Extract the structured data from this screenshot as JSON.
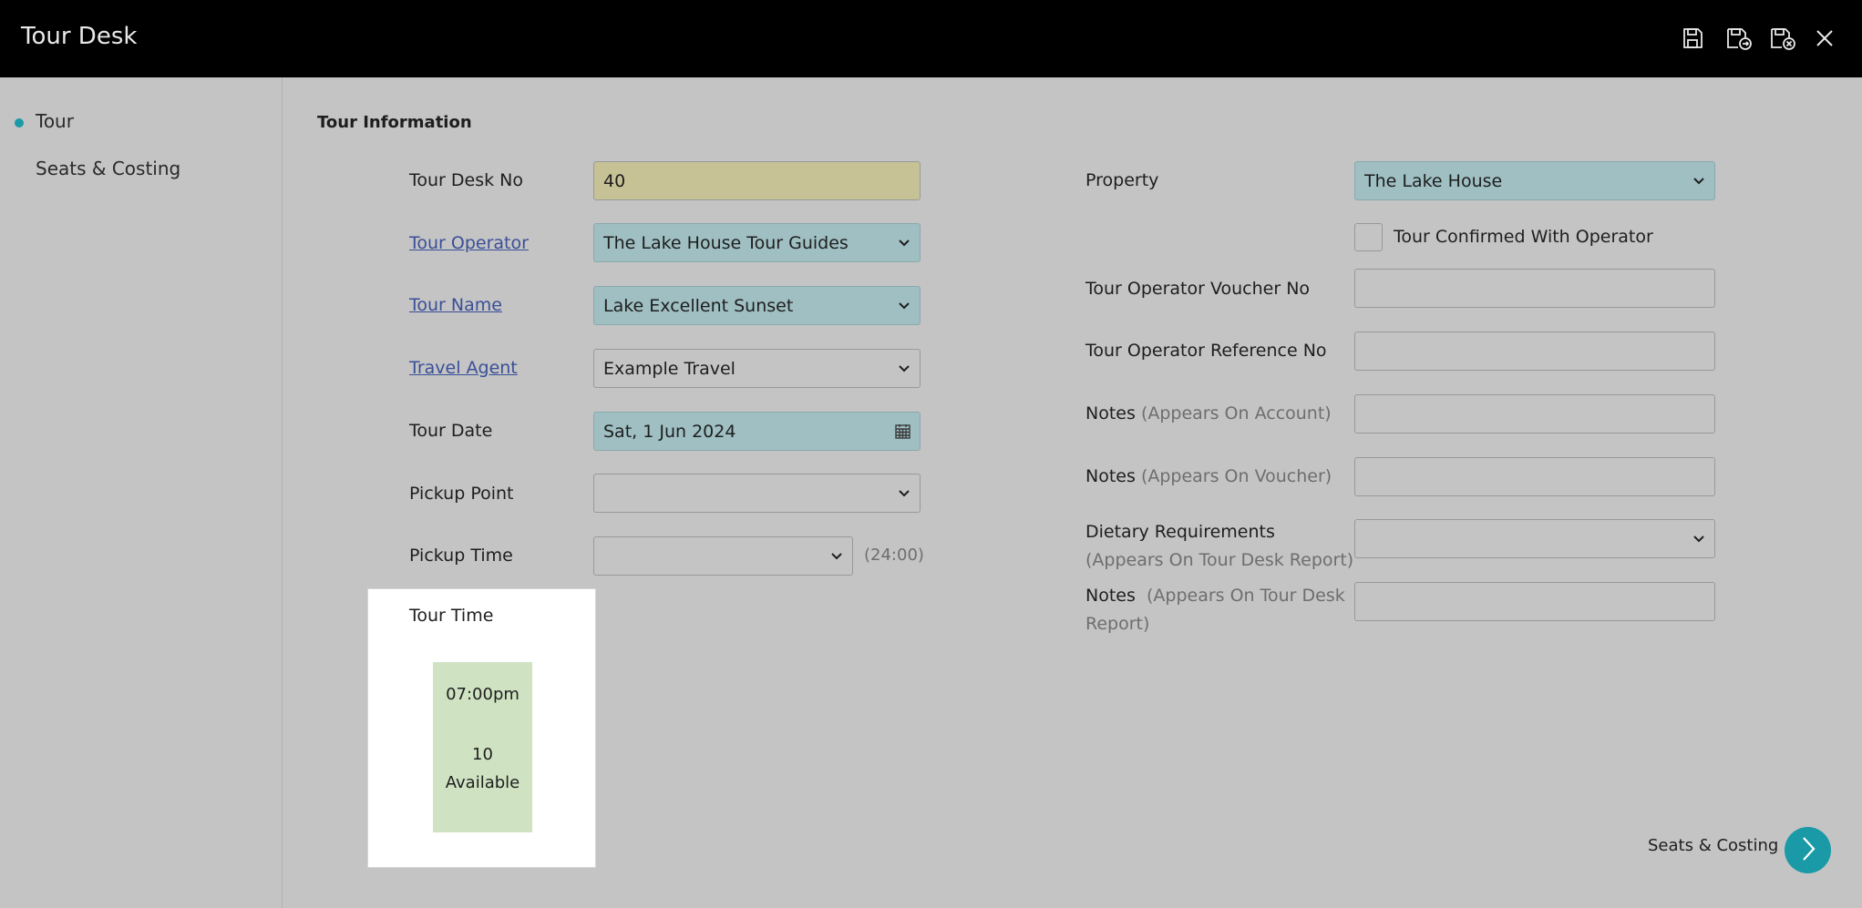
{
  "app": {
    "title": "Tour Desk"
  },
  "toolbar": {
    "save_icon": "save-icon",
    "save_and_new_icon": "save-and-new-icon",
    "save_and_close_icon": "save-and-close-icon",
    "close_icon": "close-icon"
  },
  "sidebar": {
    "items": [
      {
        "label": "Tour",
        "active": true
      },
      {
        "label": "Seats & Costing",
        "active": false
      }
    ],
    "accent": "#1a9aa6"
  },
  "section": {
    "title": "Tour Information"
  },
  "left_form": {
    "tour_desk_no": {
      "label": "Tour Desk No",
      "value": "40"
    },
    "tour_operator": {
      "label": "Tour Operator",
      "value": "The Lake House Tour Guides"
    },
    "tour_name": {
      "label": "Tour Name",
      "value": "Lake Excellent Sunset"
    },
    "travel_agent": {
      "label": "Travel Agent",
      "value": "Example Travel"
    },
    "tour_date": {
      "label": "Tour Date",
      "value": "Sat, 1 Jun 2024"
    },
    "pickup_point": {
      "label": "Pickup Point",
      "value": ""
    },
    "pickup_time": {
      "label": "Pickup Time",
      "value": "",
      "hint": "(24:00)"
    }
  },
  "tour_time": {
    "label": "Tour Time",
    "slot": {
      "time": "07:00pm",
      "count": "10",
      "availability": "Available"
    }
  },
  "right_form": {
    "property": {
      "label": "Property",
      "value": "The Lake House"
    },
    "confirmed": {
      "label": "Tour Confirmed With Operator",
      "checked": false
    },
    "voucher_no": {
      "label": "Tour Operator Voucher No",
      "value": ""
    },
    "reference_no": {
      "label": "Tour Operator Reference No",
      "value": ""
    },
    "notes_account": {
      "label": "Notes",
      "hint": "(Appears On Account)",
      "value": ""
    },
    "notes_voucher": {
      "label": "Notes",
      "hint": "(Appears On Voucher)",
      "value": ""
    },
    "dietary": {
      "label": "Dietary Requirements",
      "hint": "(Appears On Tour Desk Report)",
      "value": ""
    },
    "notes_report": {
      "label": "Notes",
      "hint": "(Appears On Tour Desk Report)",
      "value": ""
    }
  },
  "footer": {
    "next_label": "Seats & Costing"
  },
  "colors": {
    "topbar": "#000000",
    "background": "#c4c4c4",
    "accent": "#1a9aa6",
    "field_yellow": "#c6c296",
    "field_teal": "#9fbfc3",
    "slot_green": "#cfe3c2",
    "link": "#3a4f98"
  }
}
